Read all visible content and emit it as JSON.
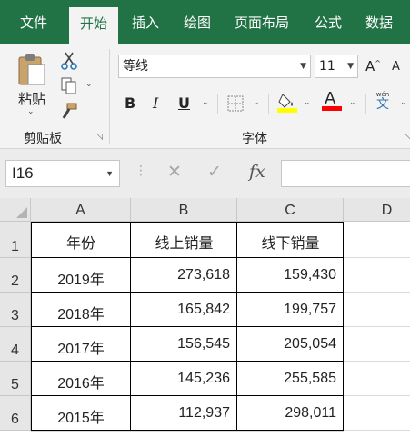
{
  "ribbon": {
    "tabs": [
      "文件",
      "开始",
      "插入",
      "绘图",
      "页面布局",
      "公式",
      "数据"
    ],
    "active_tab": "开始",
    "clipboard": {
      "paste_label": "粘贴",
      "group_label": "剪贴板"
    },
    "font": {
      "font_name": "等线",
      "font_size": "11",
      "group_label": "字体",
      "grow_label": "A",
      "shrink_label": "A",
      "bold": "B",
      "italic": "I",
      "underline": "U",
      "font_color_glyph": "A",
      "phonetic_top": "wén",
      "phonetic_bottom": "文"
    }
  },
  "formula_bar": {
    "name_box": "I16",
    "cancel": "✕",
    "enter": "✓",
    "fx": "fx",
    "value": ""
  },
  "sheet": {
    "columns": [
      "A",
      "B",
      "C",
      "D"
    ],
    "rows": [
      "1",
      "2",
      "3",
      "4",
      "5",
      "6"
    ],
    "header": [
      "年份",
      "线上销量",
      "线下销量"
    ],
    "data": [
      [
        "2019年",
        "273,618",
        "159,430"
      ],
      [
        "2018年",
        "165,842",
        "199,757"
      ],
      [
        "2017年",
        "156,545",
        "205,054"
      ],
      [
        "2016年",
        "145,236",
        "255,585"
      ],
      [
        "2015年",
        "112,937",
        "298,011"
      ]
    ]
  },
  "colors": {
    "excel_green": "#217346",
    "highlight_yellow": "#ffff00",
    "font_red": "#ff0000"
  }
}
